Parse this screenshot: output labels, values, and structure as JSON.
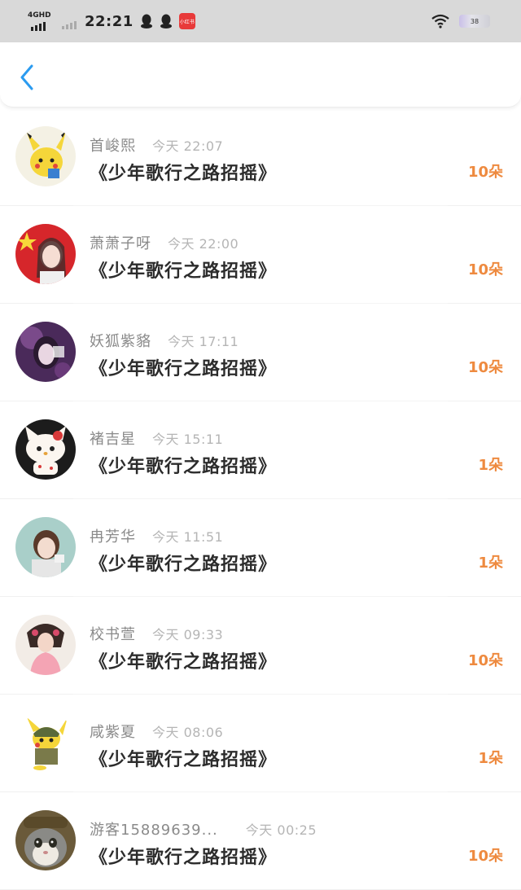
{
  "status_bar": {
    "network": "4GHD",
    "time": "22:21",
    "app_badge": "小红书",
    "battery": "38"
  },
  "colors": {
    "accent": "#2b9bf0",
    "count": "#ee8a3f",
    "status_bar_bg": "#d9d9d9"
  },
  "nav": {
    "back_icon": "chevron-left-icon"
  },
  "records": [
    {
      "name": "首峻熙",
      "time": "今天 22:07",
      "gift": "《少年歌行之路招摇》",
      "count": "10朵"
    },
    {
      "name": "萧萧子呀",
      "time": "今天 22:00",
      "gift": "《少年歌行之路招摇》",
      "count": "10朵"
    },
    {
      "name": "妖狐紫貉",
      "time": "今天 17:11",
      "gift": "《少年歌行之路招摇》",
      "count": "10朵"
    },
    {
      "name": "褚吉星",
      "time": "今天 15:11",
      "gift": "《少年歌行之路招摇》",
      "count": "1朵"
    },
    {
      "name": "冉芳华",
      "time": "今天 11:51",
      "gift": "《少年歌行之路招摇》",
      "count": "1朵"
    },
    {
      "name": "校书萱",
      "time": "今天 09:33",
      "gift": "《少年歌行之路招摇》",
      "count": "10朵"
    },
    {
      "name": "咸紫夏",
      "time": "今天 08:06",
      "gift": "《少年歌行之路招摇》",
      "count": "1朵"
    },
    {
      "name": "游客15889639...",
      "time": "今天 00:25",
      "gift": "《少年歌行之路招摇》",
      "count": "10朵"
    }
  ]
}
